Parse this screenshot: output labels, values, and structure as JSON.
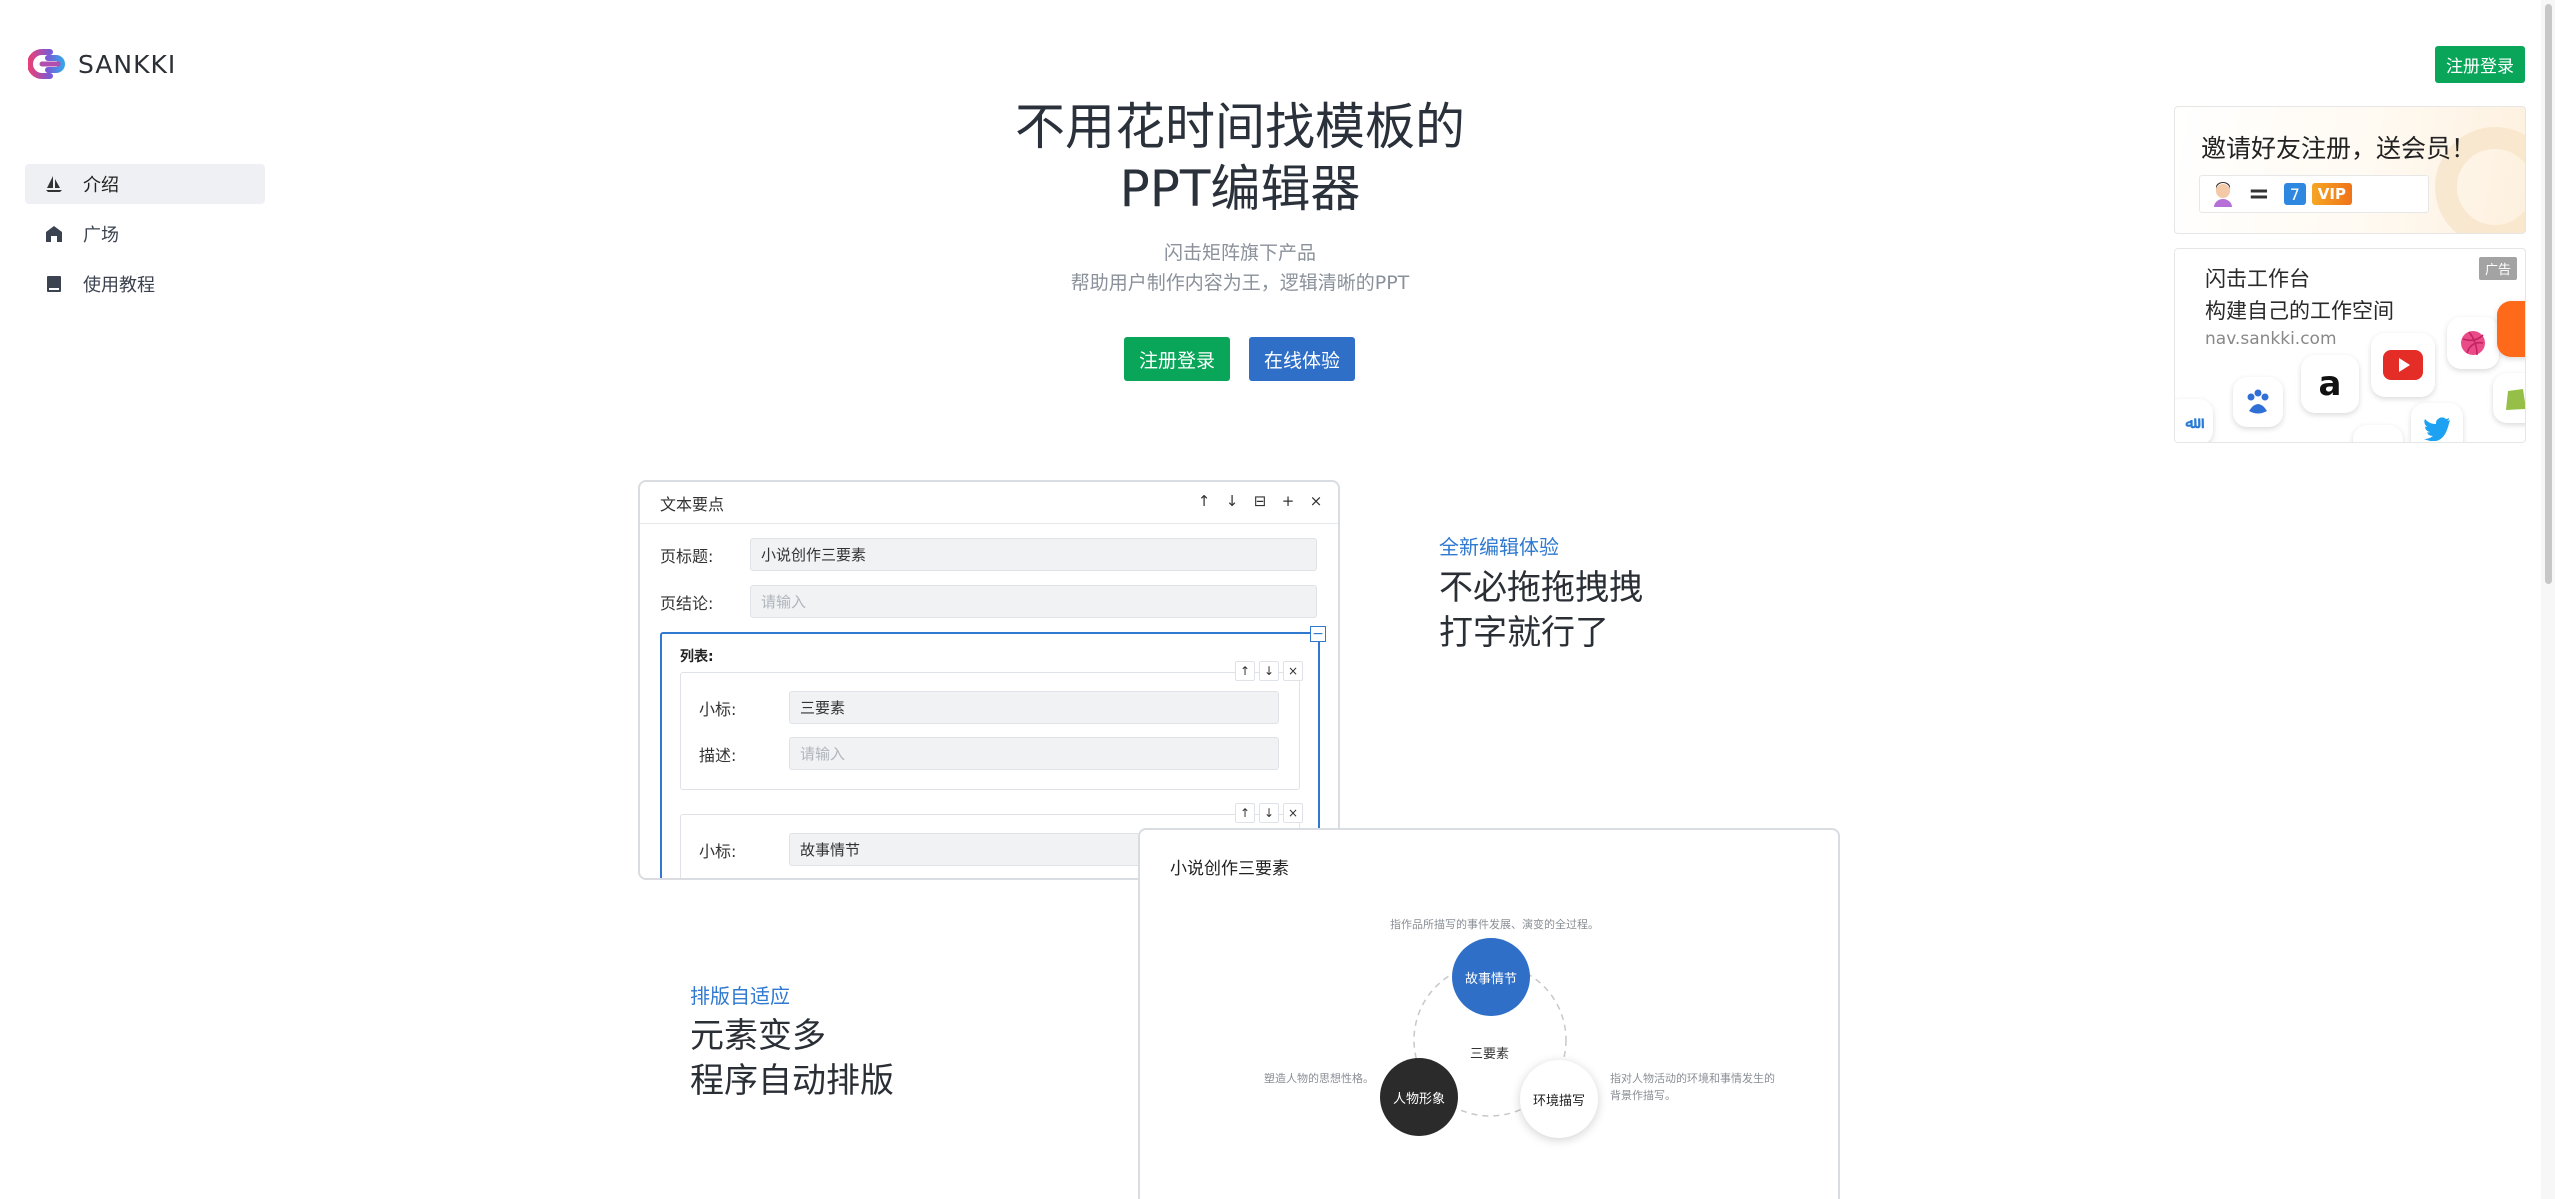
{
  "brand": {
    "name": "SANKKI"
  },
  "sidebar": {
    "items": [
      {
        "label": "介绍",
        "icon": "sailboat-icon"
      },
      {
        "label": "广场",
        "icon": "home-icon"
      },
      {
        "label": "使用教程",
        "icon": "book-icon"
      }
    ]
  },
  "header": {
    "login_label": "注册登录"
  },
  "hero": {
    "title_line1": "不用花时间找模板的",
    "title_line2": "PPT编辑器",
    "sub_line1": "闪击矩阵旗下产品",
    "sub_line2": "帮助用户制作内容为王，逻辑清晰的PPT",
    "btn_register": "注册登录",
    "btn_try": "在线体验"
  },
  "ads": {
    "invite": {
      "title": "邀请好友注册，送会员！",
      "eq": "=",
      "days": "7",
      "vip": "VIP"
    },
    "workspace": {
      "tag": "广告",
      "line1": "闪击工作台",
      "line2": "构建自己的工作空间",
      "url": "nav.sankki.com",
      "icons": [
        "baidu-icon",
        "amazon-icon",
        "youtube-icon",
        "dribbble-icon",
        "twitter-icon",
        "shopify-icon"
      ],
      "amazon_glyph": "a"
    }
  },
  "editor": {
    "title": "文本要点",
    "tools": [
      "↑",
      "↓",
      "⊟",
      "+",
      "×"
    ],
    "page_title_label": "页标题:",
    "page_title_value": "小说创作三要素",
    "page_conclusion_label": "页结论:",
    "page_conclusion_placeholder": "请输入",
    "list_label": "列表:",
    "collapse_glyph": "−",
    "item_tools": [
      "↑",
      "↓",
      "×"
    ],
    "items": [
      {
        "sub_label": "小标:",
        "sub_value": "三要素",
        "desc_label": "描述:",
        "desc_placeholder": "请输入"
      },
      {
        "sub_label": "小标:",
        "sub_value": "故事情节"
      }
    ]
  },
  "features": [
    {
      "tag": "全新编辑体验",
      "line1": "不必拖拖拽拽",
      "line2": "打字就行了"
    },
    {
      "tag": "排版自适应",
      "line1": "元素变多",
      "line2": "程序自动排版"
    }
  ],
  "slide": {
    "title": "小说创作三要素",
    "center": "三要素",
    "top_note": "指作品所描写的事件发展、演变的全过程。",
    "left_note": "塑造人物的思想性格。",
    "right_note_1": "指对人物活动的环境和事情发生的",
    "right_note_2": "背景作描写。",
    "node_top": "故事情节",
    "node_left": "人物形象",
    "node_right": "环境描写",
    "colors": {
      "top": "#2f6fc7",
      "left": "#2b2b2b",
      "right": "#ffffff"
    }
  }
}
